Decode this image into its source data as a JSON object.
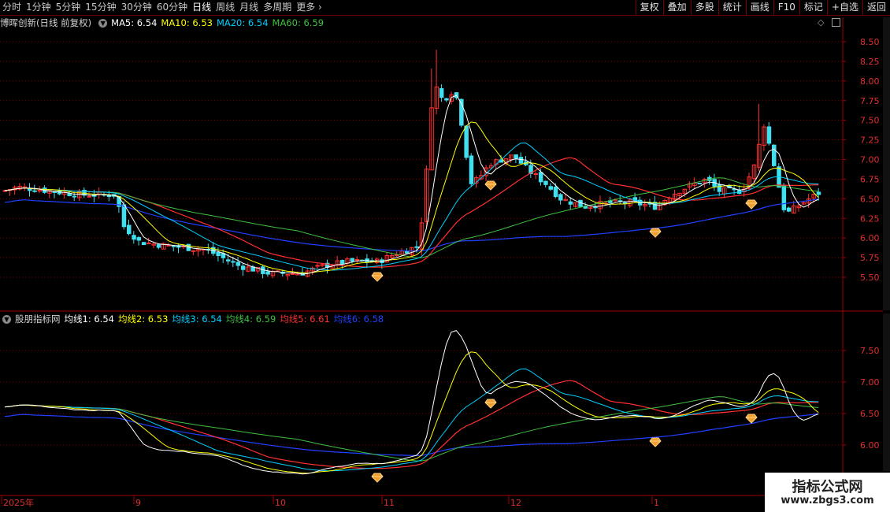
{
  "toolbar": {
    "periods": [
      "分时",
      "1分钟",
      "5分钟",
      "15分钟",
      "30分钟",
      "60分钟",
      "日线",
      "周线",
      "月线",
      "多周期",
      "更多"
    ],
    "active_period": "日线",
    "right_buttons": [
      "复权",
      "叠加",
      "多股",
      "统计",
      "画线",
      "F10",
      "标记",
      "+自选",
      "返回"
    ]
  },
  "main_legend": {
    "title": "博晖创新(日线 前复权)",
    "items": [
      {
        "text": "MA5: 6.54",
        "color": "#ffffff"
      },
      {
        "text": "MA10: 6.53",
        "color": "#ffff00"
      },
      {
        "text": "MA20: 6.54",
        "color": "#00d0ff"
      },
      {
        "text": "MA60: 6.59",
        "color": "#40c040"
      }
    ]
  },
  "sub_legend": {
    "title": "股朋指标网",
    "items": [
      {
        "text": "均线1: 6.54",
        "color": "#ffffff"
      },
      {
        "text": "均线2: 6.53",
        "color": "#ffff00"
      },
      {
        "text": "均线3: 6.54",
        "color": "#00d0ff"
      },
      {
        "text": "均线4: 6.59",
        "color": "#40c040"
      },
      {
        "text": "均线5: 6.61",
        "color": "#ff3030"
      },
      {
        "text": "均线6: 6.58",
        "color": "#2040ff"
      }
    ]
  },
  "main_axis": [
    "8.50",
    "8.25",
    "8.00",
    "7.75",
    "7.50",
    "7.25",
    "7.00",
    "6.75",
    "6.50",
    "6.25",
    "6.00",
    "5.75",
    "5.50"
  ],
  "sub_axis": [
    "7.50",
    "7.00",
    "6.50",
    "6.00"
  ],
  "date_labels": [
    "2025年",
    "9",
    "10",
    "11",
    "12",
    "1"
  ],
  "watermark": {
    "title": "指标公式网",
    "url": "www.zbgs3.com"
  },
  "colors": {
    "up": "#ff3030",
    "down": "#40e0f0",
    "grid": "#a00000"
  }
}
